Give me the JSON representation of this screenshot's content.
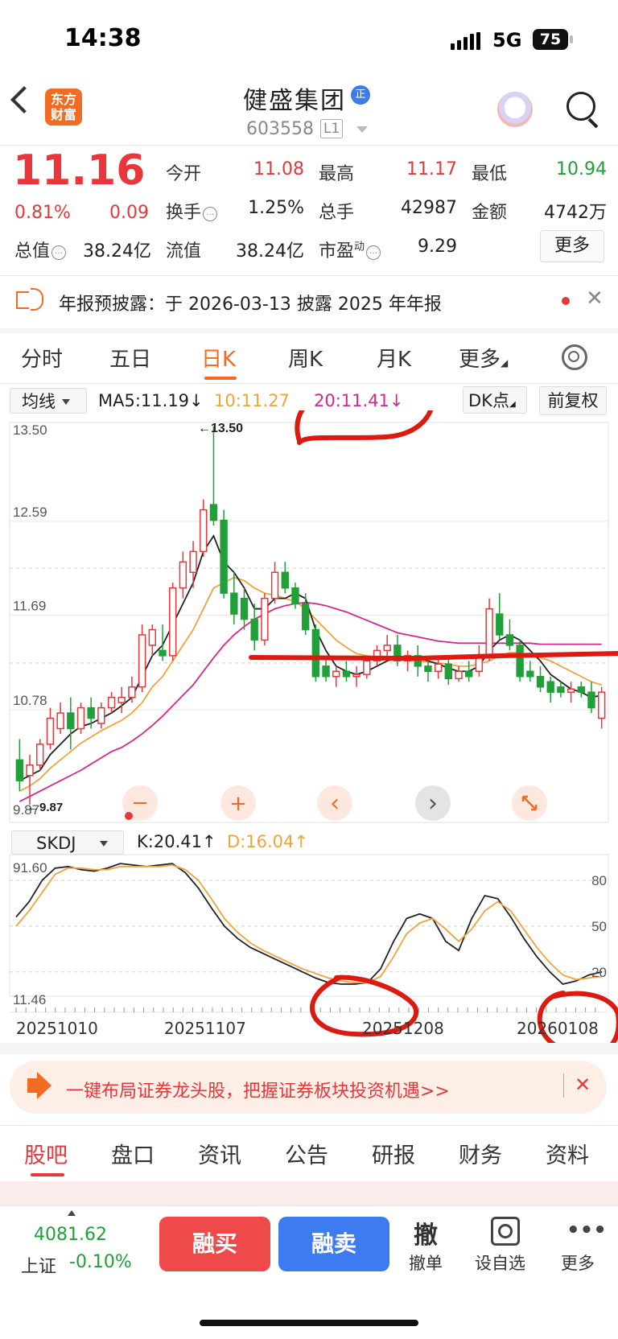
{
  "status_bar": {
    "time": "14:38",
    "network": "5G",
    "battery": "75"
  },
  "header": {
    "logo_line1": "东方",
    "logo_line2": "财富",
    "stock_name": "健盛集团",
    "verified_badge": "正",
    "stock_code": "603558",
    "level_badge": "L1"
  },
  "quote": {
    "price": "11.16",
    "change_pct": "0.81%",
    "change_abs": "0.09",
    "fields": {
      "open_label": "今开",
      "open": "11.08",
      "high_label": "最高",
      "high": "11.17",
      "low_label": "最低",
      "low": "10.94",
      "turnover_label": "换手",
      "turnover": "1.25%",
      "volume_label": "总手",
      "volume": "42987",
      "amount_label": "金额",
      "amount": "4742万",
      "total_cap_label": "总值",
      "total_cap": "38.24亿",
      "float_cap_label": "流值",
      "float_cap": "38.24亿",
      "pe_label": "市盈",
      "pe_super": "动",
      "pe": "9.29"
    },
    "more_label": "更多"
  },
  "notice": {
    "text": "年报预披露：于 2026-03-13 披露 2025 年年报"
  },
  "period_tabs": [
    "分时",
    "五日",
    "日K",
    "周K",
    "月K",
    "更多"
  ],
  "indicators": {
    "ma_select": "均线",
    "ma5": "MA5:11.19↓",
    "ma10": "10:11.27",
    "ma20": "20:11.41↓",
    "dk_select": "DK点",
    "adjust": "前复权"
  },
  "chart_controls": {
    "minus": "−",
    "plus": "+",
    "prev": "‹",
    "next": "›"
  },
  "oscillator": {
    "select": "SKDJ",
    "k": "K:20.41↑",
    "d": "D:16.04↑"
  },
  "colors": {
    "up": "#e8363a",
    "down": "#21a039",
    "ma5": "#222222",
    "ma10": "#f2a33a",
    "ma20": "#d6268f",
    "accent": "#f36b21",
    "annotation": "#dd1a10"
  },
  "chart_data": [
    {
      "type": "candlestick",
      "y_ticks": [
        "13.50",
        "12.59",
        "11.69",
        "10.78",
        "9.87"
      ],
      "ylim": [
        9.87,
        13.5
      ],
      "annotations": [
        "←13.50",
        "←9.87"
      ],
      "ohlc": [
        [
          10.3,
          10.5,
          10.0,
          10.1
        ],
        [
          10.15,
          10.35,
          9.87,
          10.25
        ],
        [
          10.25,
          10.5,
          10.2,
          10.45
        ],
        [
          10.45,
          10.8,
          10.4,
          10.7
        ],
        [
          10.6,
          10.85,
          10.55,
          10.75
        ],
        [
          10.75,
          10.9,
          10.4,
          10.6
        ],
        [
          10.6,
          10.85,
          10.55,
          10.8
        ],
        [
          10.8,
          10.9,
          10.6,
          10.7
        ],
        [
          10.65,
          10.85,
          10.6,
          10.8
        ],
        [
          10.8,
          10.95,
          10.75,
          10.9
        ],
        [
          10.85,
          11.0,
          10.75,
          10.9
        ],
        [
          10.9,
          11.1,
          10.85,
          11.0
        ],
        [
          11.0,
          11.6,
          10.95,
          11.5
        ],
        [
          11.4,
          11.6,
          11.3,
          11.55
        ],
        [
          11.35,
          11.6,
          11.25,
          11.3
        ],
        [
          11.3,
          12.0,
          11.25,
          11.95
        ],
        [
          11.95,
          12.3,
          11.85,
          12.2
        ],
        [
          12.1,
          12.4,
          11.95,
          12.3
        ],
        [
          12.3,
          12.8,
          12.25,
          12.7
        ],
        [
          12.75,
          13.5,
          12.55,
          12.6
        ],
        [
          12.6,
          12.7,
          11.85,
          11.9
        ],
        [
          11.9,
          12.1,
          11.6,
          11.7
        ],
        [
          11.85,
          11.95,
          11.55,
          11.65
        ],
        [
          11.65,
          11.8,
          11.35,
          11.45
        ],
        [
          11.45,
          11.9,
          11.4,
          11.85
        ],
        [
          11.85,
          12.2,
          11.8,
          12.1
        ],
        [
          12.1,
          12.2,
          11.9,
          11.95
        ],
        [
          11.95,
          12.0,
          11.75,
          11.8
        ],
        [
          11.8,
          11.9,
          11.5,
          11.55
        ],
        [
          11.55,
          11.6,
          11.05,
          11.1
        ],
        [
          11.2,
          11.3,
          11.05,
          11.1
        ],
        [
          11.1,
          11.2,
          11.0,
          11.15
        ],
        [
          11.15,
          11.25,
          11.05,
          11.1
        ],
        [
          11.1,
          11.2,
          11.0,
          11.12
        ],
        [
          11.12,
          11.3,
          11.08,
          11.25
        ],
        [
          11.25,
          11.4,
          11.2,
          11.35
        ],
        [
          11.35,
          11.5,
          11.3,
          11.4
        ],
        [
          11.4,
          11.5,
          11.2,
          11.25
        ],
        [
          11.25,
          11.35,
          11.15,
          11.3
        ],
        [
          11.3,
          11.4,
          11.1,
          11.2
        ],
        [
          11.2,
          11.3,
          11.05,
          11.15
        ],
        [
          11.15,
          11.28,
          11.08,
          11.22
        ],
        [
          11.22,
          11.3,
          11.02,
          11.08
        ],
        [
          11.08,
          11.2,
          11.05,
          11.15
        ],
        [
          11.15,
          11.25,
          11.05,
          11.1
        ],
        [
          11.15,
          11.4,
          11.1,
          11.3
        ],
        [
          11.3,
          11.85,
          11.25,
          11.75
        ],
        [
          11.7,
          11.9,
          11.45,
          11.5
        ],
        [
          11.5,
          11.65,
          11.35,
          11.4
        ],
        [
          11.4,
          11.45,
          11.05,
          11.1
        ],
        [
          11.15,
          11.25,
          11.05,
          11.1
        ],
        [
          11.1,
          11.2,
          10.95,
          11.0
        ],
        [
          11.05,
          11.1,
          10.85,
          10.95
        ],
        [
          11.0,
          11.05,
          10.9,
          10.95
        ],
        [
          10.95,
          11.05,
          10.85,
          10.98
        ],
        [
          11.0,
          11.05,
          10.9,
          10.95
        ],
        [
          10.95,
          11.05,
          10.75,
          10.8
        ],
        [
          10.7,
          11.0,
          10.6,
          10.95
        ]
      ],
      "ma5": [
        10.1,
        10.15,
        10.2,
        10.35,
        10.45,
        10.55,
        10.62,
        10.65,
        10.7,
        10.75,
        10.82,
        10.9,
        11.1,
        11.3,
        11.4,
        11.6,
        11.8,
        12.0,
        12.3,
        12.45,
        12.2,
        12.1,
        11.95,
        11.75,
        11.75,
        11.85,
        11.85,
        11.9,
        11.85,
        11.55,
        11.35,
        11.2,
        11.15,
        11.12,
        11.15,
        11.2,
        11.25,
        11.28,
        11.3,
        11.28,
        11.25,
        11.22,
        11.18,
        11.15,
        11.15,
        11.2,
        11.35,
        11.45,
        11.5,
        11.45,
        11.35,
        11.25,
        11.12,
        11.05,
        10.98,
        10.95,
        10.9,
        10.92
      ],
      "ma10": [
        10.0,
        10.05,
        10.12,
        10.22,
        10.3,
        10.38,
        10.46,
        10.52,
        10.58,
        10.63,
        10.68,
        10.75,
        10.85,
        11.0,
        11.1,
        11.25,
        11.4,
        11.55,
        11.75,
        11.95,
        12.0,
        12.05,
        12.02,
        11.95,
        11.9,
        11.88,
        11.85,
        11.82,
        11.75,
        11.65,
        11.55,
        11.45,
        11.38,
        11.32,
        11.3,
        11.28,
        11.27,
        11.26,
        11.25,
        11.25,
        11.24,
        11.23,
        11.22,
        11.2,
        11.2,
        11.22,
        11.25,
        11.3,
        11.33,
        11.33,
        11.3,
        11.28,
        11.25,
        11.2,
        11.15,
        11.1,
        11.05,
        11.02
      ],
      "ma20": [
        9.9,
        9.95,
        10.0,
        10.05,
        10.1,
        10.15,
        10.2,
        10.26,
        10.32,
        10.38,
        10.42,
        10.48,
        10.55,
        10.63,
        10.72,
        10.82,
        10.92,
        11.02,
        11.15,
        11.28,
        11.4,
        11.5,
        11.58,
        11.65,
        11.7,
        11.75,
        11.78,
        11.8,
        11.81,
        11.8,
        11.78,
        11.75,
        11.72,
        11.68,
        11.64,
        11.6,
        11.56,
        11.52,
        11.5,
        11.48,
        11.46,
        11.44,
        11.43,
        11.42,
        11.42,
        11.42,
        11.42,
        11.42,
        11.42,
        11.42,
        11.42,
        11.41,
        11.41,
        11.41,
        11.41,
        11.41,
        11.41,
        11.41
      ]
    },
    {
      "type": "line",
      "name": "SKDJ",
      "y_ticks_left": [
        "91.60",
        "11.46"
      ],
      "y_ticks_right": [
        "80",
        "50",
        "20"
      ],
      "ylim": [
        11.46,
        91.6
      ],
      "x_tick_labels": [
        "20251010",
        "20251107",
        "20251208",
        "20260108"
      ],
      "series": [
        {
          "name": "K",
          "values": [
            56,
            66,
            80,
            88,
            89,
            87,
            86,
            88,
            91,
            90,
            89,
            90,
            91,
            85,
            75,
            62,
            50,
            42,
            36,
            32,
            28,
            24,
            20,
            16,
            13,
            12,
            12,
            13,
            22,
            40,
            55,
            58,
            55,
            40,
            34,
            55,
            70,
            68,
            56,
            42,
            30,
            20,
            12,
            14,
            18,
            20
          ]
        },
        {
          "name": "D",
          "values": [
            50,
            60,
            72,
            84,
            88,
            88,
            87,
            87,
            89,
            89,
            89,
            89,
            90,
            87,
            80,
            68,
            55,
            46,
            39,
            34,
            30,
            26,
            22,
            19,
            16,
            14,
            13,
            13,
            17,
            30,
            45,
            52,
            55,
            48,
            40,
            48,
            60,
            66,
            60,
            48,
            36,
            26,
            18,
            15,
            16,
            17
          ]
        }
      ]
    }
  ],
  "promo": {
    "text": "一键布局证券龙头股，把握证券板块投资机遇>>"
  },
  "bottom_tabs": [
    "股吧",
    "盘口",
    "资讯",
    "公告",
    "研报",
    "财务",
    "资料"
  ],
  "index": {
    "value": "4081.62",
    "name": "上证",
    "change": "-0.10%"
  },
  "actions": {
    "buy_margin": "融买",
    "sell_margin": "融卖",
    "cancel_glyph": "撤",
    "cancel_label": "撤单",
    "watch_label": "设自选",
    "more_label": "更多"
  }
}
